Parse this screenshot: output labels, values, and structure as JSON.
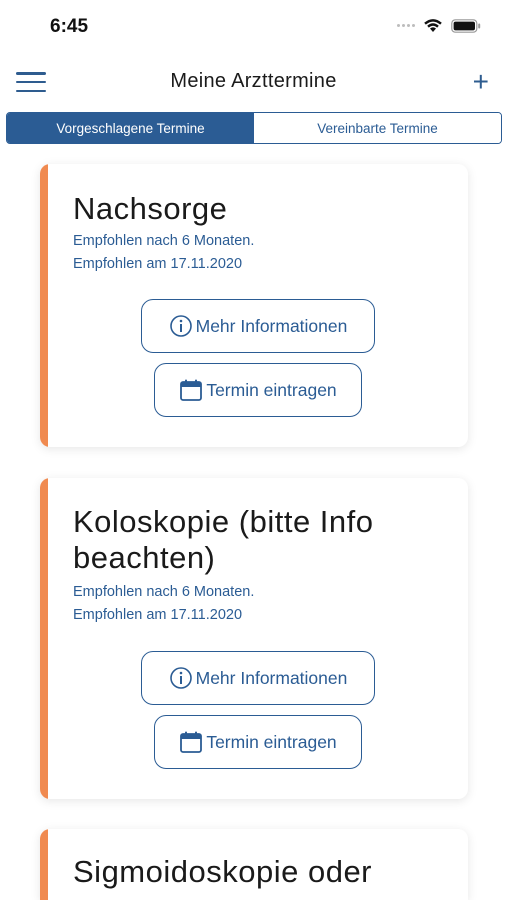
{
  "status_bar": {
    "time": "6:45"
  },
  "nav": {
    "title": "Meine Arzttermine",
    "add_label": "+"
  },
  "tabs": [
    {
      "label": "Vorgeschlagene Termine",
      "active": true
    },
    {
      "label": "Vereinbarte Termine",
      "active": false
    }
  ],
  "cards": [
    {
      "title_lines": [
        "Nachsorge"
      ],
      "recommended_after": "Empfohlen nach 6 Monaten.",
      "recommended_on": "Empfohlen am 17.11.2020",
      "info_button": "Mehr Informationen",
      "add_button": "Termin eintragen"
    },
    {
      "title_lines": [
        "Koloskopie (bitte Info",
        "beachten)"
      ],
      "recommended_after": "Empfohlen nach 6 Monaten.",
      "recommended_on": "Empfohlen am 17.11.2020",
      "info_button": "Mehr Informationen",
      "add_button": "Termin eintragen"
    },
    {
      "title_lines": [
        "Sigmoidoskopie oder"
      ]
    }
  ],
  "colors": {
    "accent": "#2b5c94",
    "card_stripe": "#f08a50"
  }
}
